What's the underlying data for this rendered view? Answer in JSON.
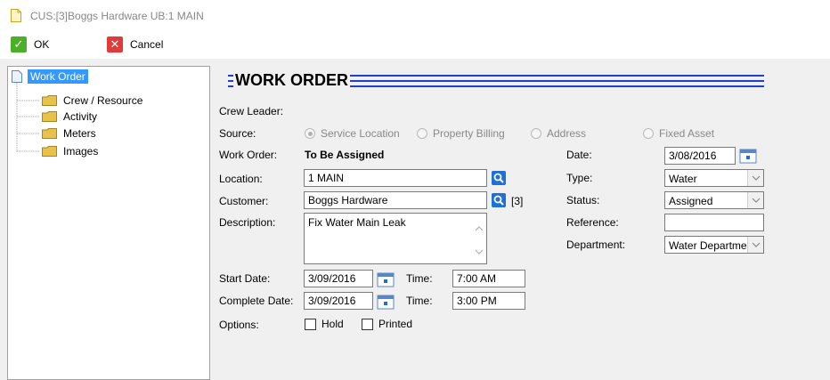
{
  "window": {
    "title": "CUS:[3]Boggs Hardware UB:1 MAIN"
  },
  "toolbar": {
    "ok_label": "OK",
    "cancel_label": "Cancel"
  },
  "tree": {
    "root": "Work Order",
    "items": [
      "Crew / Resource",
      "Activity",
      "Meters",
      "Images"
    ]
  },
  "form": {
    "header": "WORK ORDER",
    "crew_leader_label": "Crew Leader:",
    "source_label": "Source:",
    "source_options": [
      "Service Location",
      "Property Billing",
      "Address",
      "Fixed Asset"
    ],
    "source_selected": "Service Location",
    "work_order_label": "Work Order:",
    "work_order_value": "To Be Assigned",
    "location_label": "Location:",
    "location_value": "1 MAIN",
    "customer_label": "Customer:",
    "customer_value": "Boggs Hardware",
    "customer_id": "[3]",
    "description_label": "Description:",
    "description_value": "Fix Water Main Leak",
    "start_date_label": "Start Date:",
    "start_date_value": "3/09/2016",
    "start_time_label": "Time:",
    "start_time_value": "7:00 AM",
    "complete_date_label": "Complete Date:",
    "complete_date_value": "3/09/2016",
    "complete_time_label": "Time:",
    "complete_time_value": "3:00 PM",
    "options_label": "Options:",
    "hold_label": "Hold",
    "printed_label": "Printed",
    "date_label": "Date:",
    "date_value": "3/08/2016",
    "type_label": "Type:",
    "type_value": "Water",
    "status_label": "Status:",
    "status_value": "Assigned",
    "reference_label": "Reference:",
    "reference_value": "",
    "department_label": "Department:",
    "department_value": "Water Departme"
  },
  "colors": {
    "accent": "#1e3fd0",
    "selection": "#3399ff",
    "ok": "#4caf28",
    "cancel": "#e23a3a"
  }
}
